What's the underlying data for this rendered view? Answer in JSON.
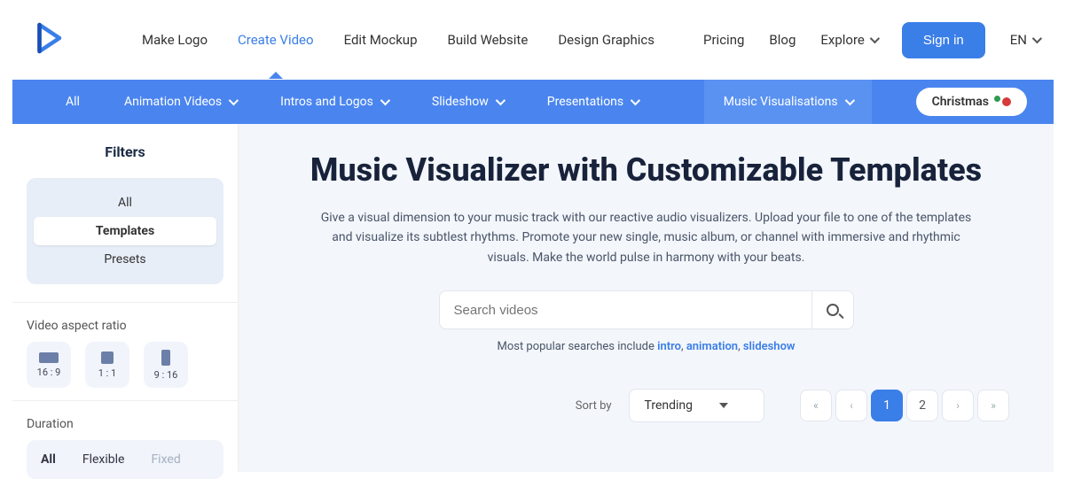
{
  "header": {
    "nav_items": [
      {
        "label": "Make Logo",
        "active": false
      },
      {
        "label": "Create Video",
        "active": true
      },
      {
        "label": "Edit Mockup",
        "active": false
      },
      {
        "label": "Build Website",
        "active": false
      },
      {
        "label": "Design Graphics",
        "active": false
      }
    ],
    "pricing": "Pricing",
    "blog": "Blog",
    "explore": "Explore",
    "signin": "Sign in",
    "lang": "EN"
  },
  "categories": {
    "items": [
      {
        "label": "All",
        "dropdown": false
      },
      {
        "label": "Animation Videos",
        "dropdown": true
      },
      {
        "label": "Intros and Logos",
        "dropdown": true
      },
      {
        "label": "Slideshow",
        "dropdown": true
      },
      {
        "label": "Presentations",
        "dropdown": true
      }
    ],
    "highlight": {
      "label": "Music Visualisations",
      "dropdown": true
    },
    "christmas": "Christmas"
  },
  "sidebar": {
    "title": "Filters",
    "tabs": {
      "all": "All",
      "templates": "Templates",
      "presets": "Presets",
      "active": "templates"
    },
    "aspect": {
      "label": "Video aspect ratio",
      "options": [
        {
          "label": "16 : 9",
          "shape": "r169"
        },
        {
          "label": "1 : 1",
          "shape": "r11"
        },
        {
          "label": "9 : 16",
          "shape": "r916"
        }
      ]
    },
    "duration": {
      "label": "Duration",
      "options": [
        {
          "label": "All",
          "state": "bold"
        },
        {
          "label": "Flexible",
          "state": ""
        },
        {
          "label": "Fixed",
          "state": "muted"
        }
      ]
    }
  },
  "main": {
    "title": "Music Visualizer with Customizable Templates",
    "desc": "Give a visual dimension to your music track with our reactive audio visualizers. Upload your file to one of the templates and visualize its subtlest rhythms. Promote your new single, music album, or channel with immersive and rhythmic visuals. Make the world pulse in harmony with your beats.",
    "search_placeholder": "Search videos",
    "popular_label": "Most popular searches include ",
    "popular_links": [
      "intro",
      "animation",
      "slideshow"
    ],
    "sort_label": "Sort by",
    "sort_value": "Trending",
    "pages": {
      "current": "1",
      "other": "2"
    }
  }
}
